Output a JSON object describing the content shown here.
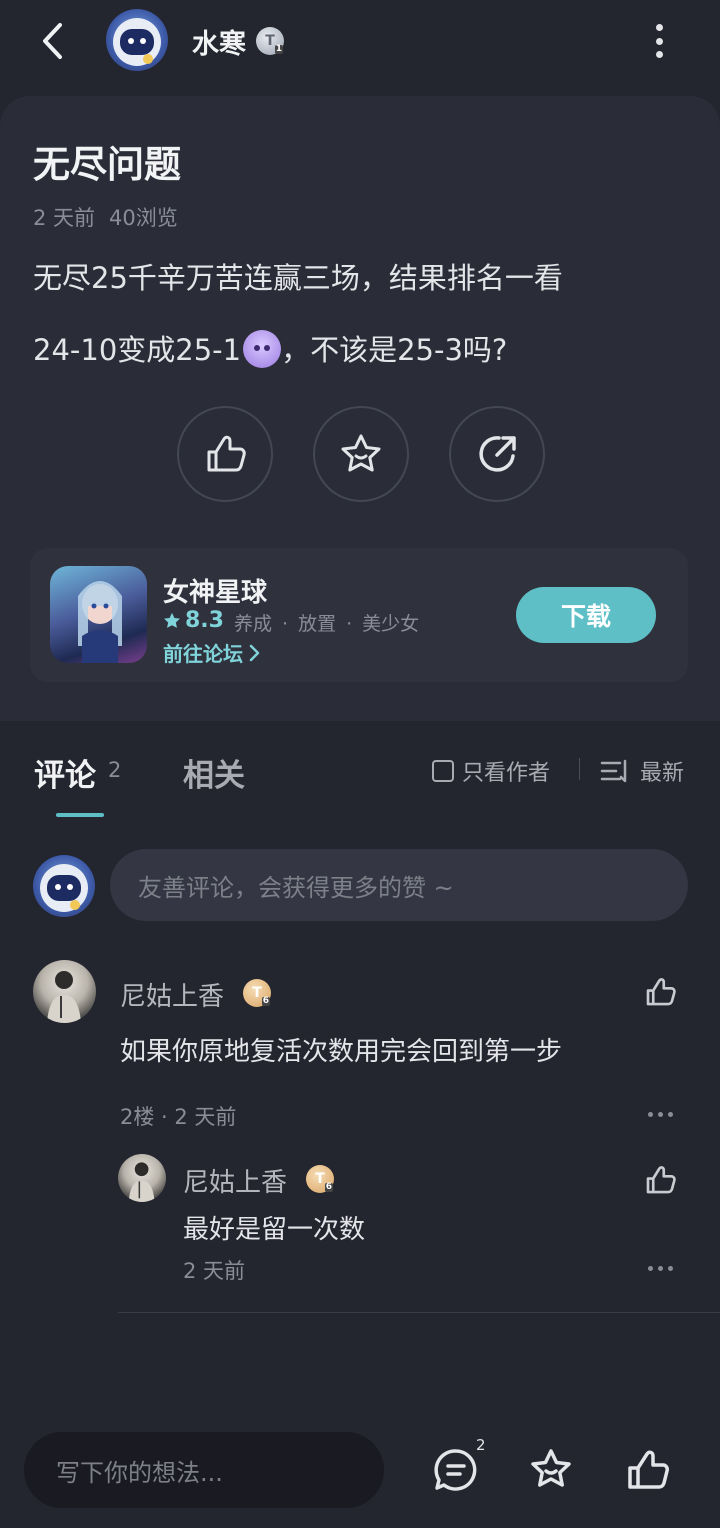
{
  "header": {
    "username": "水寒",
    "badge_letter": "T",
    "badge_level": "1"
  },
  "post": {
    "title": "无尽问题",
    "time": "2 天前",
    "views": "40浏览",
    "line1": "无尽25千辛万苦连赢三场，结果排名一看",
    "line2_a": "24-10变成25-1",
    "line2_b": "，不该是25-3吗?"
  },
  "game": {
    "name": "女神星球",
    "rating": "8.3",
    "tags": [
      "养成",
      "放置",
      "美少女"
    ],
    "forum_label": "前往论坛",
    "download_label": "下载"
  },
  "tabs": {
    "comment_label": "评论",
    "comment_count": "2",
    "related_label": "相关",
    "only_author_label": "只看作者",
    "sort_label": "最新"
  },
  "composer": {
    "placeholder": "友善评论，会获得更多的赞 ~"
  },
  "comments": [
    {
      "author": "尼姑上香",
      "badge_letter": "T",
      "badge_level": "6",
      "text": "如果你原地复活次数用完会回到第一步",
      "meta": "2楼 · 2 天前",
      "reply": {
        "author": "尼姑上香",
        "badge_letter": "T",
        "badge_level": "6",
        "text": "最好是留一次数",
        "meta": "2 天前"
      }
    }
  ],
  "bottom_bar": {
    "placeholder": "写下你的想法...",
    "comment_count": "2"
  },
  "colors": {
    "accent": "#5ebfc6",
    "background": "#23252f",
    "card": "#2a2c37"
  }
}
